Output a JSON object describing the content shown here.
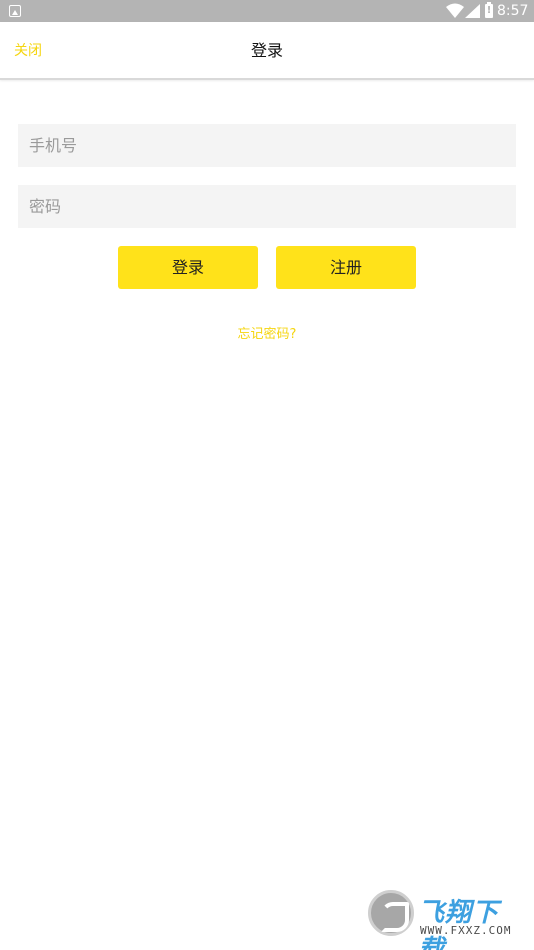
{
  "status_bar": {
    "time": "8:57",
    "icons": [
      "app-notification-icon",
      "wifi-icon",
      "signal-icon",
      "battery-alert-icon"
    ]
  },
  "header": {
    "close_label": "关闭",
    "title": "登录"
  },
  "form": {
    "phone_placeholder": "手机号",
    "phone_value": "",
    "password_placeholder": "密码",
    "password_value": "",
    "login_label": "登录",
    "register_label": "注册",
    "forgot_label": "忘记密码?"
  },
  "watermark": {
    "brand": "飞翔下载",
    "url": "WWW.FXXZ.COM"
  },
  "colors": {
    "accent": "#ffe21a",
    "accent_text": "#f5d50f",
    "status_bar": "#b4b4b4",
    "field_bg": "#f4f4f4"
  }
}
